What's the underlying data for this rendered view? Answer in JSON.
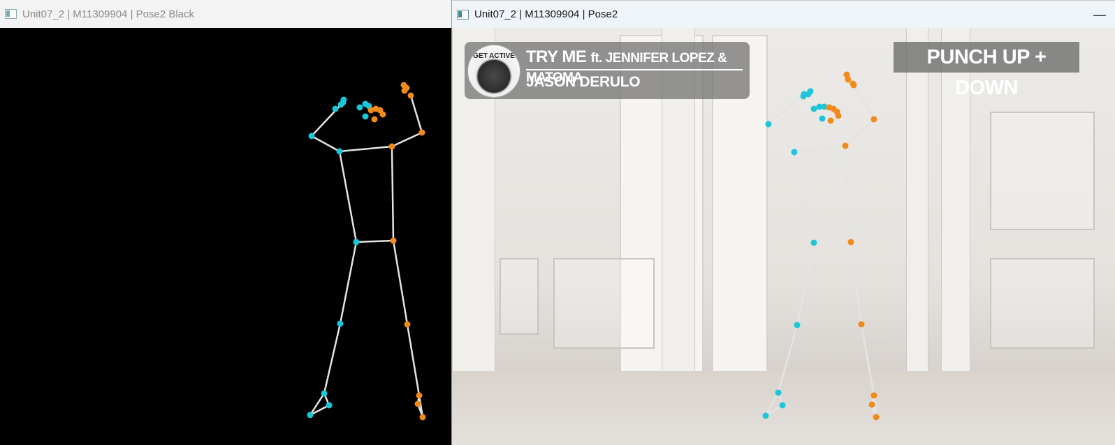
{
  "windows": {
    "pose_black": {
      "title": "Unit07_2 | M11309904 | Pose2 Black"
    },
    "pose_video": {
      "title": "Unit07_2 | M11309904 | Pose2",
      "minimize_symbol": "—"
    }
  },
  "overlay": {
    "album_text": "GET ACTIVE",
    "song_title": "TRY ME",
    "song_feat": "ft.  JENNIFER LOPEZ & MATOMA",
    "song_artist": "JASON DERULO",
    "move_label": "PUNCH UP + DOWN"
  },
  "colors": {
    "left_joint": "#1cc6d8",
    "right_joint": "#f08a1a",
    "bone": "#e4e4e4"
  }
}
